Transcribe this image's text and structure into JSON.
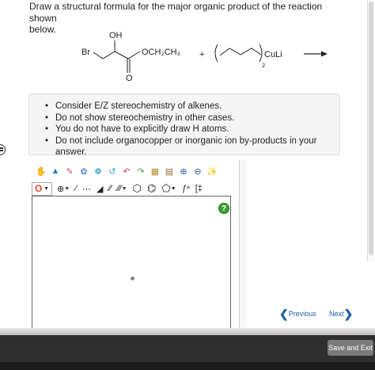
{
  "question": {
    "line1": "Draw a structural formula for the major organic product of the reaction shown",
    "line2": "below."
  },
  "reaction": {
    "reactant1": {
      "br": "Br",
      "oh": "OH",
      "ester": "OCH₂CH₃",
      "carbonyl_o": "O"
    },
    "plus": "+",
    "reactant2": {
      "subscript": "2",
      "cuprate": "CuLi"
    }
  },
  "hints": [
    "Consider E/Z stereochemistry of alkenes.",
    "Do not show stereochemistry in other cases.",
    "You do not have to explicitly draw H atoms.",
    "Do not include organocopper or inorganic ion by-products in your answer."
  ],
  "editor": {
    "element_selected": "O",
    "help": "?"
  },
  "navigation": {
    "previous": "Previous",
    "next": "Next"
  },
  "footer": {
    "save_exit": "Save and Exit"
  },
  "colors": {
    "accent_blue": "#1a5fa6",
    "help_green": "#3aa335",
    "oxygen_red": "#e14b2b",
    "footer_dark": "#2f2f2f"
  }
}
